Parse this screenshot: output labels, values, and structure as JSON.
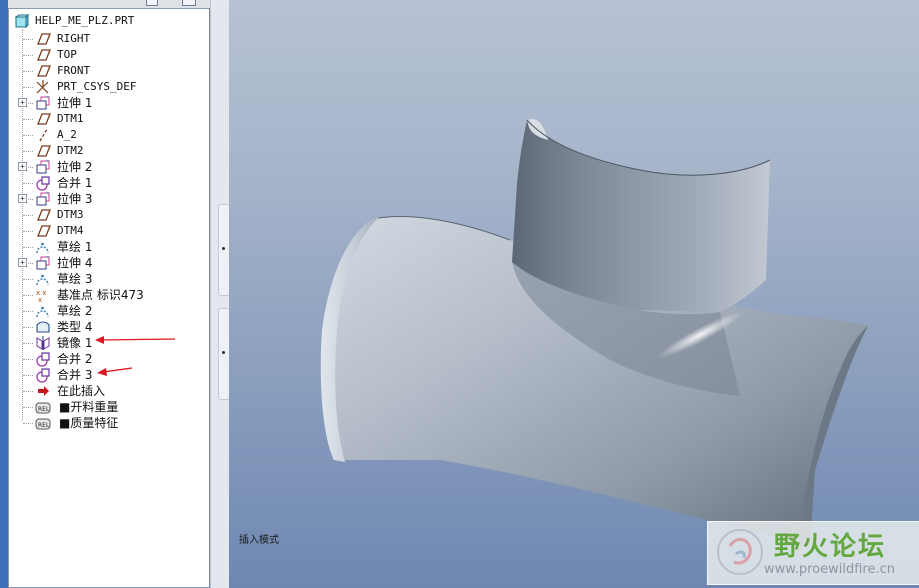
{
  "model_tree": {
    "root_label": "HELP_ME_PLZ.PRT",
    "items": [
      {
        "label": "RIGHT",
        "icon": "datum-plane-icon",
        "expandable": false
      },
      {
        "label": "TOP",
        "icon": "datum-plane-icon",
        "expandable": false
      },
      {
        "label": "FRONT",
        "icon": "datum-plane-icon",
        "expandable": false
      },
      {
        "label": "PRT_CSYS_DEF",
        "icon": "csys-icon",
        "expandable": false
      },
      {
        "label": "拉伸 1",
        "icon": "extrude-icon",
        "expandable": true
      },
      {
        "label": "DTM1",
        "icon": "datum-plane-icon",
        "expandable": false
      },
      {
        "label": "A_2",
        "icon": "datum-axis-icon",
        "expandable": false
      },
      {
        "label": "DTM2",
        "icon": "datum-plane-icon",
        "expandable": false
      },
      {
        "label": "拉伸 2",
        "icon": "extrude-icon",
        "expandable": true
      },
      {
        "label": "合并 1",
        "icon": "merge-icon",
        "expandable": false
      },
      {
        "label": "拉伸 3",
        "icon": "extrude-icon",
        "expandable": true
      },
      {
        "label": "DTM3",
        "icon": "datum-plane-icon",
        "expandable": false
      },
      {
        "label": "DTM4",
        "icon": "datum-plane-icon",
        "expandable": false
      },
      {
        "label": "草绘 1",
        "icon": "sketch-icon",
        "expandable": false
      },
      {
        "label": "拉伸 4",
        "icon": "extrude-icon",
        "expandable": true
      },
      {
        "label": "草绘 3",
        "icon": "sketch-icon",
        "expandable": false
      },
      {
        "label": "基准点 标识473",
        "icon": "datum-point-icon",
        "expandable": false
      },
      {
        "label": "草绘 2",
        "icon": "sketch-icon",
        "expandable": false
      },
      {
        "label": "类型 4",
        "icon": "style-surface-icon",
        "expandable": false
      },
      {
        "label": "镜像 1",
        "icon": "mirror-icon",
        "expandable": false
      },
      {
        "label": "合并 2",
        "icon": "merge-icon",
        "expandable": false
      },
      {
        "label": "合并 3",
        "icon": "merge-icon",
        "expandable": false
      },
      {
        "label": "在此插入",
        "icon": "insert-here-arrow-icon",
        "expandable": false
      },
      {
        "label": "■开料重量",
        "icon": "relation-param-icon",
        "expandable": false
      },
      {
        "label": "■质量特征",
        "icon": "relation-param-icon",
        "expandable": false
      }
    ]
  },
  "viewport": {
    "status_text": "插入模式",
    "model": "tee-pipe-surface",
    "background_top": "#b6c1d3",
    "background_bottom": "#6f88b2"
  },
  "annotations": [
    {
      "type": "red-arrow",
      "points_to": "镜像 1",
      "color": "#e0141c"
    },
    {
      "type": "red-arrow",
      "points_to": "合并 3",
      "color": "#e0141c"
    }
  ],
  "watermark": {
    "title": "野火论坛",
    "url": "www.proewildfire.cn"
  }
}
